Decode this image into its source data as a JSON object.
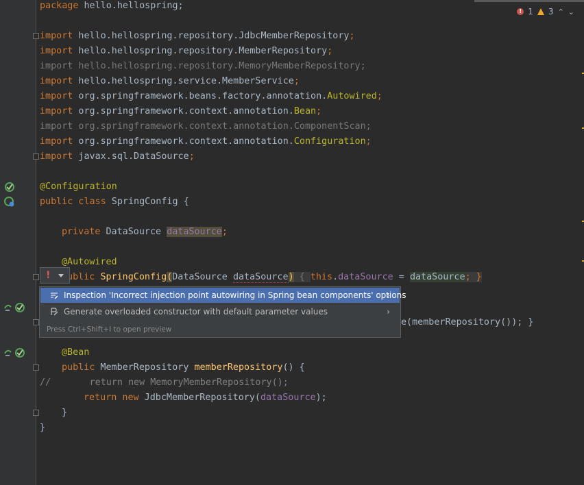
{
  "status": {
    "errors": "1",
    "warnings": "3"
  },
  "code_lines": {
    "l1_kw": "package",
    "l1_rest": " hello.hellospring;",
    "imports": [
      {
        "kw": "import",
        "path": " hello.hellospring.repository.JdbcMemberRepository",
        "hl": "",
        "end": ";"
      },
      {
        "kw": "import",
        "path": " hello.hellospring.repository.MemberRepository",
        "hl": "",
        "end": ";"
      },
      {
        "kw": "import",
        "path": " hello.hellospring.repository.MemoryMemberRepository",
        "hl": "",
        "end": ";"
      },
      {
        "kw": "import",
        "path": " hello.hellospring.service.MemberService",
        "hl": "",
        "end": ";"
      },
      {
        "kw": "import",
        "path": " org.springframework.beans.factory.annotation.",
        "hl": "Autowired",
        "end": ";"
      },
      {
        "kw": "import",
        "path": " org.springframework.context.annotation.",
        "hl": "Bean",
        "end": ";"
      },
      {
        "kw": "import",
        "path": " org.springframework.context.annotation.ComponentScan",
        "hl": "",
        "end": ";"
      },
      {
        "kw": "import",
        "path": " org.springframework.context.annotation.",
        "hl": "Configuration",
        "end": ";"
      },
      {
        "kw": "import",
        "path": " javax.sql.DataSource",
        "hl": "",
        "end": ";"
      }
    ],
    "configuration_annotation": "@Configuration",
    "class_kw": "public class",
    "class_name": " SpringConfig {",
    "private_kw": "private",
    "datasource_type": " DataSource ",
    "datasource_field": "dataSource",
    "semicolon": ";",
    "autowired_annotation": "@Autowired",
    "public_kw": "public",
    "ctor_name": "SpringConfig",
    "paren_open": "(",
    "ctor_param_type": "DataSource ",
    "ctor_param": "dataSource",
    "paren_close": ")",
    "ctor_body_open": " { ",
    "this_kw": "this",
    "dot": ".",
    "assign": " = ",
    "ctor_body_end": "; }",
    "hidden_line_tail": "e(memberRepository()); }",
    "bean_annotation": "@Bean",
    "bean_type": " MemberRepository ",
    "bean_method": "memberRepository",
    "bean_sig_end": "() {",
    "comment_line": "//       return new MemoryMemberRepository();",
    "return_kw": "return new",
    "return_rest": " JdbcMemberRepository(",
    "return_arg": "dataSource",
    "return_end": ");",
    "close_method": "}",
    "close_class": "}"
  },
  "popup": {
    "items": [
      {
        "label": "Inspection 'Incorrect injection point autowiring in Spring bean components' options",
        "icon": "inspection-icon"
      },
      {
        "label": "Generate overloaded constructor with default parameter values",
        "icon": "generate-icon"
      }
    ],
    "hint": "Press Ctrl+Shift+I to open preview"
  },
  "colors": {
    "background": "#2b2b2b",
    "keyword": "#cc7832",
    "annotation": "#bbb529",
    "field": "#9876aa",
    "method": "#ffc66d",
    "selection": "#4b6eaf"
  }
}
